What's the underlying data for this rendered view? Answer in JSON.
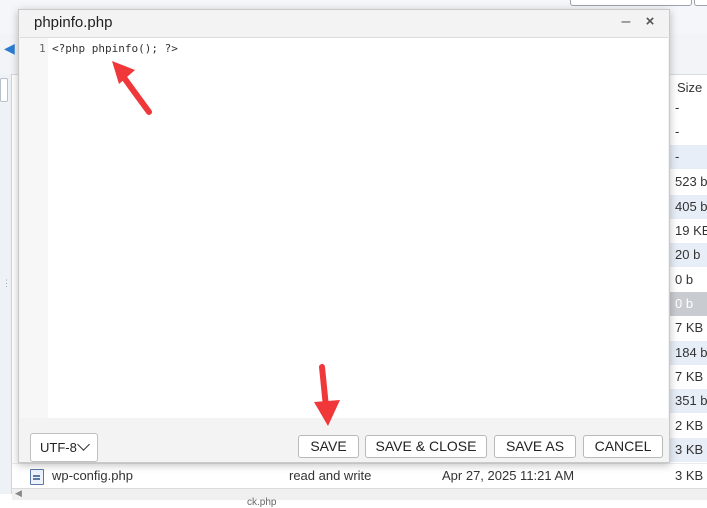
{
  "dialog": {
    "title": "phpinfo.php",
    "minimize_glyph": "–",
    "close_glyph": "×"
  },
  "editor": {
    "line_number": "1",
    "code": "<?php phpinfo(); ?>"
  },
  "footer": {
    "encoding": "UTF-8",
    "save": "SAVE",
    "save_close": "SAVE & CLOSE",
    "save_as": "SAVE AS",
    "cancel": "CANCEL"
  },
  "background": {
    "size_header": "Size",
    "sizes": [
      "-",
      "-",
      "-",
      "523 b",
      "405 b",
      "19 KB",
      "20 b",
      "0 b",
      "0 b",
      "7 KB",
      "184 b",
      "7 KB",
      "351 b",
      "2 KB",
      "3 KB"
    ],
    "bottom_row": {
      "name": "wp-config.php",
      "permissions": "read and write",
      "modified": "Apr 27, 2025 11:21 AM",
      "size": "3 KB"
    },
    "bottom_partial": "ck.php"
  },
  "colors": {
    "annotation_arrow": "#f0373a",
    "row_alt": "#e8eef7",
    "row_selected": "#c8cbd0"
  }
}
